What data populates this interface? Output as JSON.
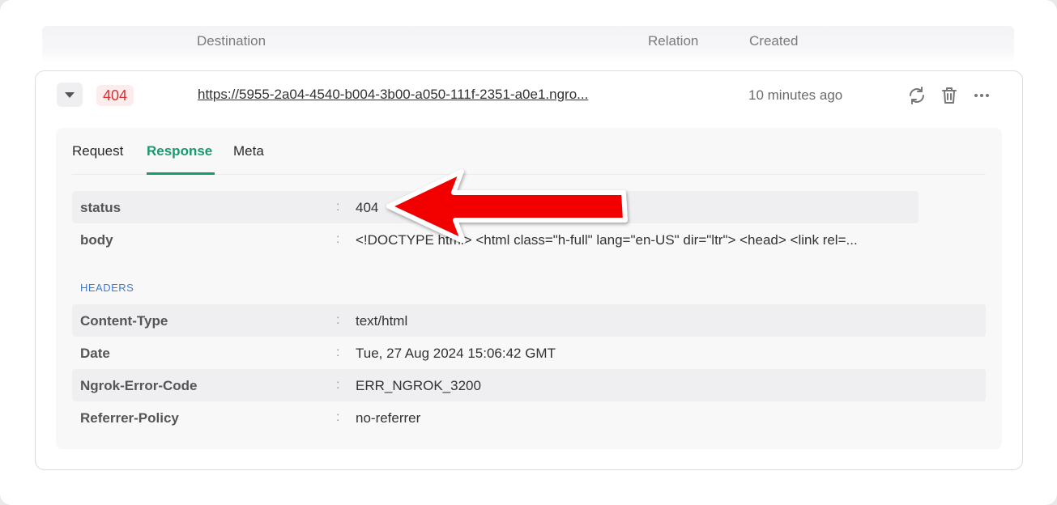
{
  "table_header": {
    "destination": "Destination",
    "relation": "Relation",
    "created": "Created"
  },
  "row": {
    "status_badge": "404",
    "destination_url": "https://5955-2a04-4540-b004-3b00-a050-111f-2351-a0e1.ngro...",
    "created": "10 minutes ago",
    "actions": [
      "refresh-icon",
      "trash-icon",
      "more-icon"
    ]
  },
  "tabs": [
    {
      "label": "Request",
      "active": false
    },
    {
      "label": "Response",
      "active": true
    },
    {
      "label": "Meta",
      "active": false
    }
  ],
  "response": {
    "fields": [
      {
        "key": "status",
        "value": "404"
      },
      {
        "key": "body",
        "value": "<!DOCTYPE html> <html class=\"h-full\" lang=\"en-US\" dir=\"ltr\"> <head> <link rel=..."
      }
    ],
    "headers_title": "HEADERS",
    "headers": [
      {
        "key": "Content-Type",
        "value": "text/html"
      },
      {
        "key": "Date",
        "value": "Tue, 27 Aug 2024 15:06:42 GMT"
      },
      {
        "key": "Ngrok-Error-Code",
        "value": "ERR_NGROK_3200"
      },
      {
        "key": "Referrer-Policy",
        "value": "no-referrer"
      }
    ],
    "separator": ":"
  },
  "colors": {
    "accent": "#1a9a6c",
    "error": "#d93030",
    "annotation_arrow": "#f20000"
  }
}
